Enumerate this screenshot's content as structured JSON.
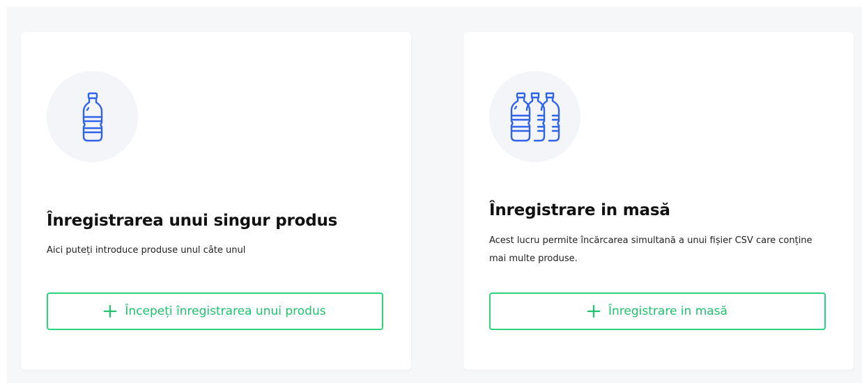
{
  "colors": {
    "accent_green": "#2bd47d",
    "icon_blue": "#2f63ea",
    "panel_bg": "#f6f7f9",
    "card_bg": "#ffffff"
  },
  "cards": [
    {
      "icon": "single-bottle-icon",
      "title": "Înregistrarea unui singur produs",
      "description": "Aici puteți introduce produse unul câte unul",
      "button_label": "Începeți înregistrarea unui produs",
      "button_icon": "plus-icon"
    },
    {
      "icon": "multiple-bottles-icon",
      "title": "Înregistrare in masă",
      "description": "Acest lucru permite încărcarea simultană a unui fișier CSV care conține mai multe produse.",
      "button_label": "Înregistrare in masă",
      "button_icon": "plus-icon"
    }
  ]
}
